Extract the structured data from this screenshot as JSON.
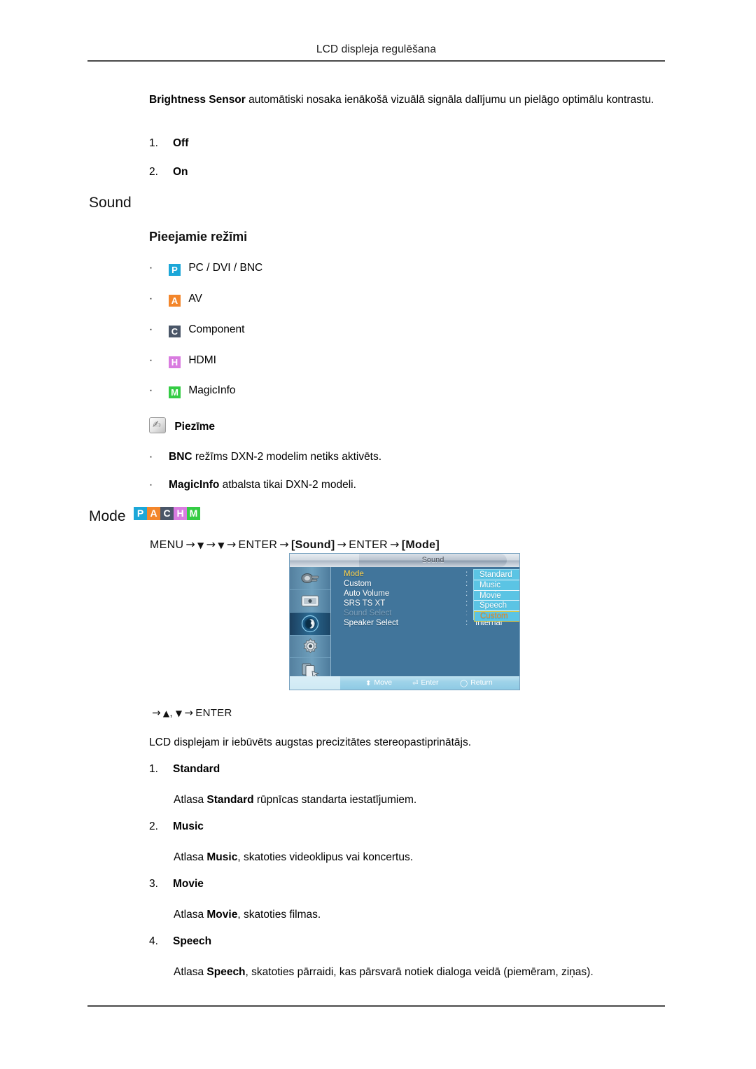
{
  "header": {
    "title": "LCD displeja regulēšana"
  },
  "intro": {
    "bold_lead": "Brightness Sensor",
    "rest": " automātiski nosaka ienākošā vizuālā signāla dalījumu un pielāgo optimālu kontrastu.",
    "options": [
      {
        "num": "1.",
        "label": "Off"
      },
      {
        "num": "2.",
        "label": "On"
      }
    ]
  },
  "sound_section": {
    "title": "Sound",
    "subtitle": "Pieejamie režīmi",
    "modes": [
      {
        "icon": "P",
        "icon_color": "#1ca7d8",
        "label": "PC / DVI / BNC"
      },
      {
        "icon": "A",
        "icon_color": "#f3862b",
        "label": "AV"
      },
      {
        "icon": "C",
        "icon_color": "#4a5668",
        "label": "Component"
      },
      {
        "icon": "H",
        "icon_color": "#d97ce0",
        "label": "HDMI"
      },
      {
        "icon": "M",
        "icon_color": "#34cc44",
        "label": "MagicInfo"
      }
    ],
    "note": {
      "title": "Piezīme",
      "items": [
        {
          "bold": "BNC",
          "rest": " režīms DXN-2 modelim netiks aktivēts."
        },
        {
          "bold": "MagicInfo",
          "rest": " atbalsta tikai DXN-2 modeli."
        }
      ]
    }
  },
  "mode_section": {
    "title": "Mode",
    "badges": [
      "P",
      "A",
      "C",
      "H",
      "M"
    ],
    "path": {
      "menu": "MENU",
      "arrow": "→",
      "down": "▼",
      "enter": "ENTER",
      "bracket_open": "[",
      "bracket_close": "]",
      "sound": "Sound",
      "mode": "Mode"
    },
    "path_after": {
      "arrow": "→",
      "up": "▲",
      "comma": ",",
      "down": "▼",
      "enter": "ENTER"
    },
    "description": "LCD displejam ir iebūvēts augstas precizitātes stereopastiprinātājs.",
    "items": [
      {
        "num": "1.",
        "title": "Standard",
        "desc_pre": "Atlasa ",
        "desc_bold": "Standard",
        "desc_post": " rūpnīcas standarta iestatījumiem."
      },
      {
        "num": "2.",
        "title": "Music",
        "desc_pre": "Atlasa ",
        "desc_bold": "Music",
        "desc_post": ", skatoties videoklipus vai koncertus."
      },
      {
        "num": "3.",
        "title": "Movie",
        "desc_pre": "Atlasa ",
        "desc_bold": "Movie",
        "desc_post": ", skatoties filmas."
      },
      {
        "num": "4.",
        "title": "Speech",
        "desc_pre": "Atlasa ",
        "desc_bold": "Speech",
        "desc_post": ", skatoties pārraidi, kas pārsvarā notiek dialoga veidā (piemēram, ziņas)."
      }
    ]
  },
  "osd": {
    "title": "Sound",
    "sidebar_icons": [
      "input-source-icon",
      "picture-icon",
      "sound-icon",
      "setup-gear-icon",
      "multi-control-icon"
    ],
    "selected_sidebar_index": 2,
    "menu_items": [
      {
        "label": "Mode",
        "state": "highlight",
        "colon": ":"
      },
      {
        "label": "Custom",
        "state": "normal",
        "colon": ":"
      },
      {
        "label": "Auto Volume",
        "state": "normal",
        "colon": ":"
      },
      {
        "label": "SRS TS XT",
        "state": "normal",
        "colon": ":"
      },
      {
        "label": "Sound Select",
        "state": "disabled",
        "colon": ":"
      },
      {
        "label": "Speaker Select",
        "state": "normal",
        "colon": ":",
        "value": "Internal"
      }
    ],
    "dropdown": {
      "options": [
        "Standard",
        "Music",
        "Movie",
        "Speech",
        "Custom"
      ],
      "selected": "Custom",
      "selected_border_color": "#d8c84a",
      "selected_text_color": "#f08a1e",
      "background": "#5bc4e4"
    },
    "footer": [
      {
        "icon": "up-down-arrow-icon",
        "glyph": "⬍",
        "label": "Move"
      },
      {
        "icon": "enter-key-icon",
        "glyph": "⏎",
        "label": "Enter"
      },
      {
        "icon": "return-icon",
        "glyph": "◯",
        "label": "Return"
      }
    ],
    "background_color": "#41759b"
  }
}
